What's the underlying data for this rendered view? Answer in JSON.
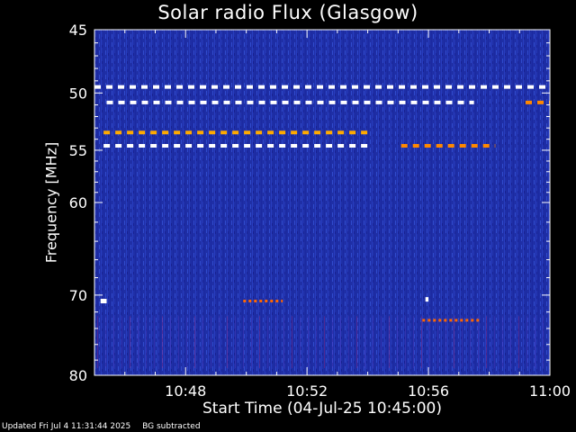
{
  "chart_data": {
    "type": "heatmap",
    "title": "Solar radio Flux (Glasgow)",
    "xlabel": "Start Time (04-Jul-25 10:45:00)",
    "ylabel": "Frequency [MHz]",
    "x_axis": {
      "range": [
        "10:45",
        "11:00"
      ],
      "range_minutes": [
        0,
        15
      ],
      "tick_labels": [
        "10:48",
        "10:52",
        "10:56",
        "11:00"
      ],
      "tick_minutes": [
        3,
        7,
        11,
        15
      ]
    },
    "y_axis": {
      "scale": "log",
      "range": [
        45,
        80
      ],
      "inverted": true,
      "tick_labels": [
        "45",
        "50",
        "55",
        "60",
        "70",
        "80"
      ],
      "tick_values": [
        45,
        50,
        55,
        60,
        70,
        80
      ]
    },
    "background_color": "#1e2fa8",
    "features": [
      {
        "name": "interference band",
        "freq_mhz": 49.5,
        "t_start_min": 0,
        "t_end_min": 15,
        "color": "#ffffff"
      },
      {
        "name": "interference band",
        "freq_mhz": 50.8,
        "t_start_min": 0.4,
        "t_end_min": 12.5,
        "color": "#ffffff"
      },
      {
        "name": "interference band",
        "freq_mhz": 50.8,
        "t_start_min": 14.2,
        "t_end_min": 15,
        "color": "#ff8800"
      },
      {
        "name": "interference band",
        "freq_mhz": 53.4,
        "t_start_min": 0.3,
        "t_end_min": 9.0,
        "color": "#ffaa00"
      },
      {
        "name": "interference band",
        "freq_mhz": 54.6,
        "t_start_min": 0.3,
        "t_end_min": 9.0,
        "color": "#ffffff"
      },
      {
        "name": "interference band",
        "freq_mhz": 54.6,
        "t_start_min": 10.1,
        "t_end_min": 13.2,
        "color": "#ff8800"
      },
      {
        "name": "burst",
        "freq_mhz": 70.7,
        "t_start_min": 4.9,
        "t_end_min": 6.2,
        "color": "#ff6600"
      },
      {
        "name": "burst",
        "freq_mhz": 73.0,
        "t_start_min": 10.8,
        "t_end_min": 12.7,
        "color": "#ff6600"
      },
      {
        "name": "spike",
        "freq_mhz": 70.7,
        "t_start_min": 0.2,
        "t_end_min": 0.4,
        "color": "#ffffff"
      },
      {
        "name": "spike",
        "freq_mhz": 70.5,
        "t_start_min": 10.9,
        "t_end_min": 11.0,
        "color": "#ffffff"
      }
    ]
  },
  "footer": {
    "updated": "Updated Fri Jul  4 11:31:44 2025",
    "note": "BG subtracted"
  }
}
